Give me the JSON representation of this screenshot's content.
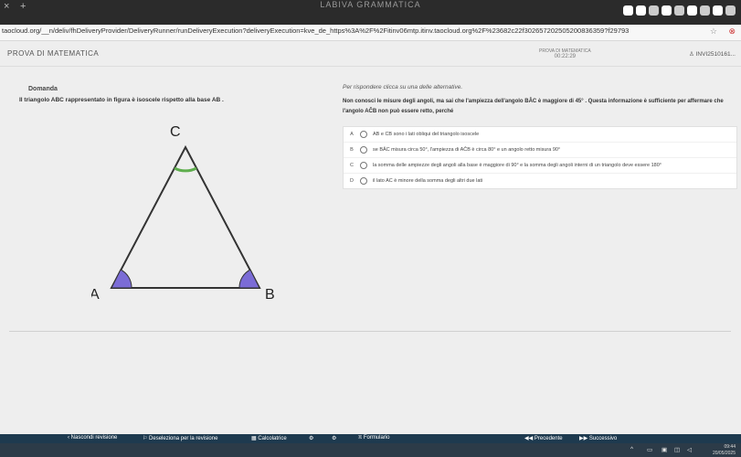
{
  "browser": {
    "title": "LABIVA GRAMMATICA",
    "url": "taocloud.org/__n/deliv/fhDeliveryProvider/DeliveryRunner/runDeliveryExecution?deliveryExecution=kve_de_https%3A%2F%2Fitinv06mtp.itinv.taocloud.org%2F%23682c22f302657202505200836359?f29793",
    "star_icon": "star-icon",
    "ext_icon": "extension-icon"
  },
  "header": {
    "test_title": "PROVA DI MATEMATICA",
    "center_title": "PROVA DI MATEMATICA",
    "timer": "00:22:29",
    "code": "INVI2510161..."
  },
  "question": {
    "heading": "Domanda",
    "stem": "Il triangolo ABC rappresentato in figura è isoscele rispetto alla base AB .",
    "prompt": "Per rispondere clicca su una delle alternative.",
    "text": "Non conosci le misure degli angoli, ma sai che l'ampiezza dell'angolo BÂC è maggiore di 45° . Questa informazione è sufficiente per affermare che l'angolo AĈB non può essere retto, perché",
    "choices": [
      {
        "letter": "A",
        "text": "AB e CB sono i lati obliqui del triangolo isoscele"
      },
      {
        "letter": "B",
        "text": "se BÂC misura circa 50°, l'ampiezza di AĈB è circa 80° e un angolo retto misura 90°"
      },
      {
        "letter": "C",
        "text": "la somma delle ampiezze degli angoli alla base è maggiore di 90° e la somma degli angoli interni di un triangolo deve essere 180°"
      },
      {
        "letter": "D",
        "text": "il lato AC è minore della somma degli altri due lati"
      }
    ]
  },
  "figure": {
    "label_a": "A",
    "label_b": "B",
    "label_c": "C",
    "angle_color": "#7b6cd6",
    "arc_color_c": "#5fae4e"
  },
  "footer": {
    "hide_review": "Nascondi revisione",
    "deselect_review": "Deseleziona per la revisione",
    "calculator": "Calcolatrice",
    "formulary": "Formulario",
    "previous": "Precedente",
    "next": "Successivo",
    "time": "09:44",
    "date": "20/05/2025"
  }
}
